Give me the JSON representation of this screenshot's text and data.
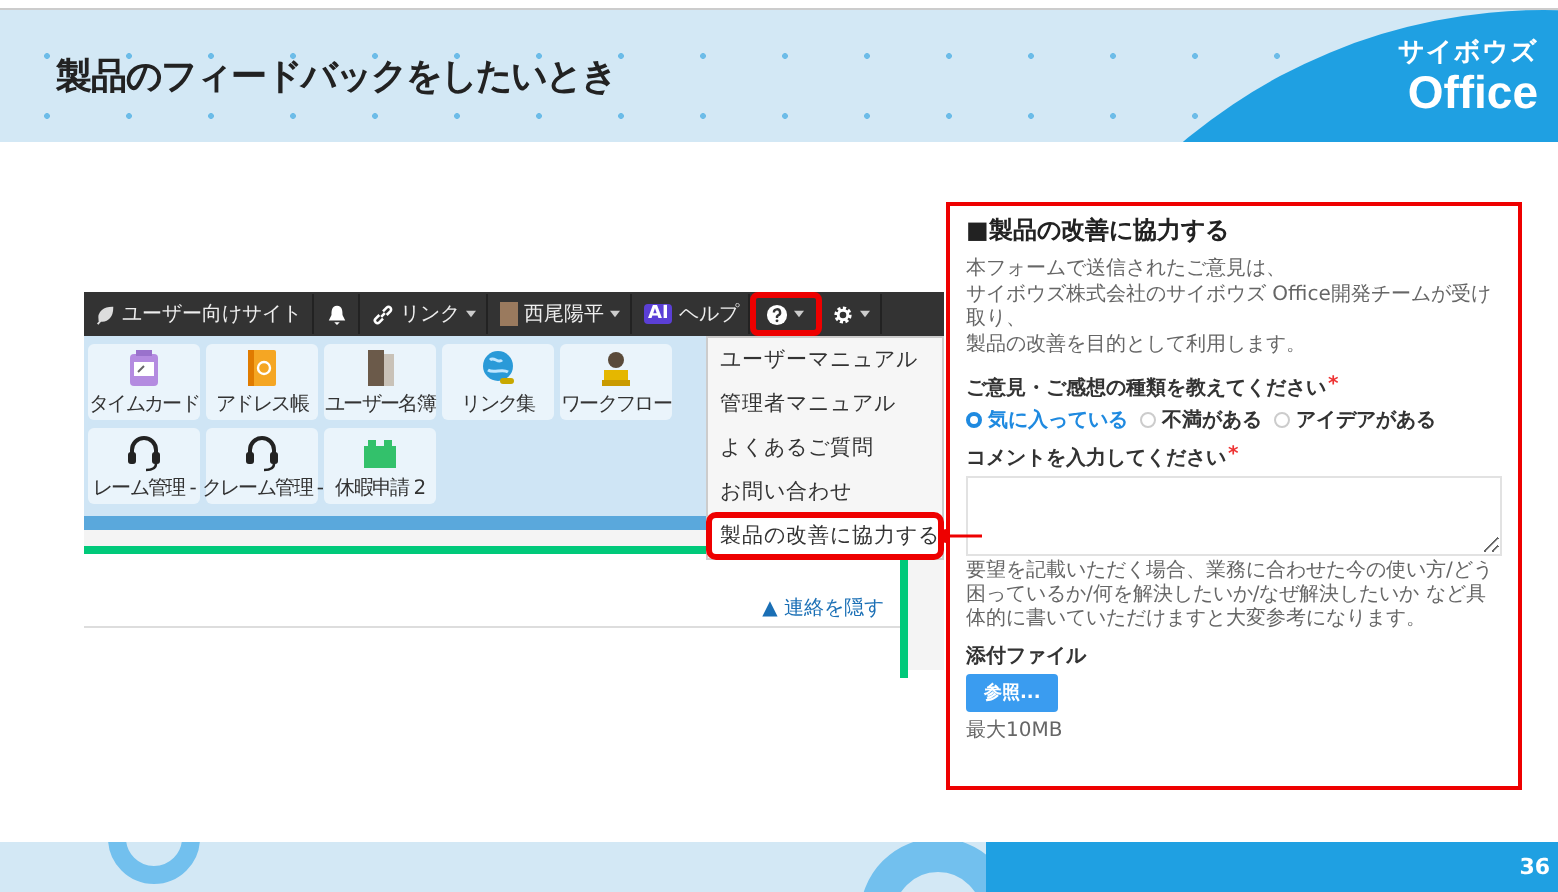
{
  "header": {
    "title": "製品のフィードバックをしたいとき",
    "logo_top": "サイボウズ",
    "logo_bottom": "Office"
  },
  "navbar": {
    "items": [
      {
        "kind": "site",
        "label": "ユーザー向けサイト",
        "highlighted": false
      },
      {
        "kind": "bell",
        "highlighted": false
      },
      {
        "kind": "link",
        "label": "リンク",
        "highlighted": false
      },
      {
        "kind": "user",
        "label": "西尾陽平",
        "highlighted": false
      },
      {
        "kind": "ai",
        "badge": "AI",
        "label": "ヘルプ",
        "highlighted": false
      },
      {
        "kind": "help",
        "highlighted": true
      },
      {
        "kind": "settings",
        "highlighted": false
      }
    ]
  },
  "apps": {
    "rows": [
      [
        {
          "kind": "timecard",
          "label": "タイムカード"
        },
        {
          "kind": "address",
          "label": "アドレス帳"
        },
        {
          "kind": "directory",
          "label": "ユーザー名簿"
        },
        {
          "kind": "globe",
          "label": "リンク集"
        },
        {
          "kind": "stamp",
          "label": "ワークフロー"
        }
      ],
      [
        {
          "kind": "headset",
          "label": "レーム管理 -"
        },
        {
          "kind": "headset",
          "label": "クレーム管理 -"
        },
        {
          "kind": "block",
          "label": "休暇申請 2"
        }
      ]
    ]
  },
  "help_menu": {
    "items": [
      {
        "label": "ユーザーマニュアル",
        "highlighted": false
      },
      {
        "label": "管理者マニュアル",
        "highlighted": false
      },
      {
        "label": "よくあるご質問",
        "highlighted": false
      },
      {
        "label": "お問い合わせ",
        "highlighted": false
      },
      {
        "label": "製品の改善に協力する",
        "highlighted": true
      }
    ]
  },
  "notice_link": "▲ 連絡を隠す",
  "form": {
    "title": "■製品の改善に協力する",
    "description": [
      "本フォームで送信されたご意見は、",
      "サイボウズ株式会社のサイボウズ Office開発チームが受け取り、",
      "製品の改善を目的として利用します。"
    ],
    "questions": [
      {
        "kind": "radio",
        "label": "ご意見・ご感想の種類を教えてください",
        "required_mark": "*",
        "options": [
          {
            "label": "気に入っている",
            "selected": true
          },
          {
            "label": "不満がある",
            "selected": false
          },
          {
            "label": "アイデアがある",
            "selected": false
          }
        ]
      },
      {
        "kind": "textarea",
        "label": "コメントを入力してください",
        "required_mark": "*",
        "hint": "要望を記載いただく場合、業務に合わせた今の使い方/どう困っているか/何を解決したいか/なぜ解決したいか など具体的に書いていただけますと大変参考になります。"
      },
      {
        "kind": "file",
        "label": "添付ファイル",
        "button": "参照...",
        "note": "最大10MB"
      }
    ]
  },
  "footer": {
    "page_number": "36"
  }
}
